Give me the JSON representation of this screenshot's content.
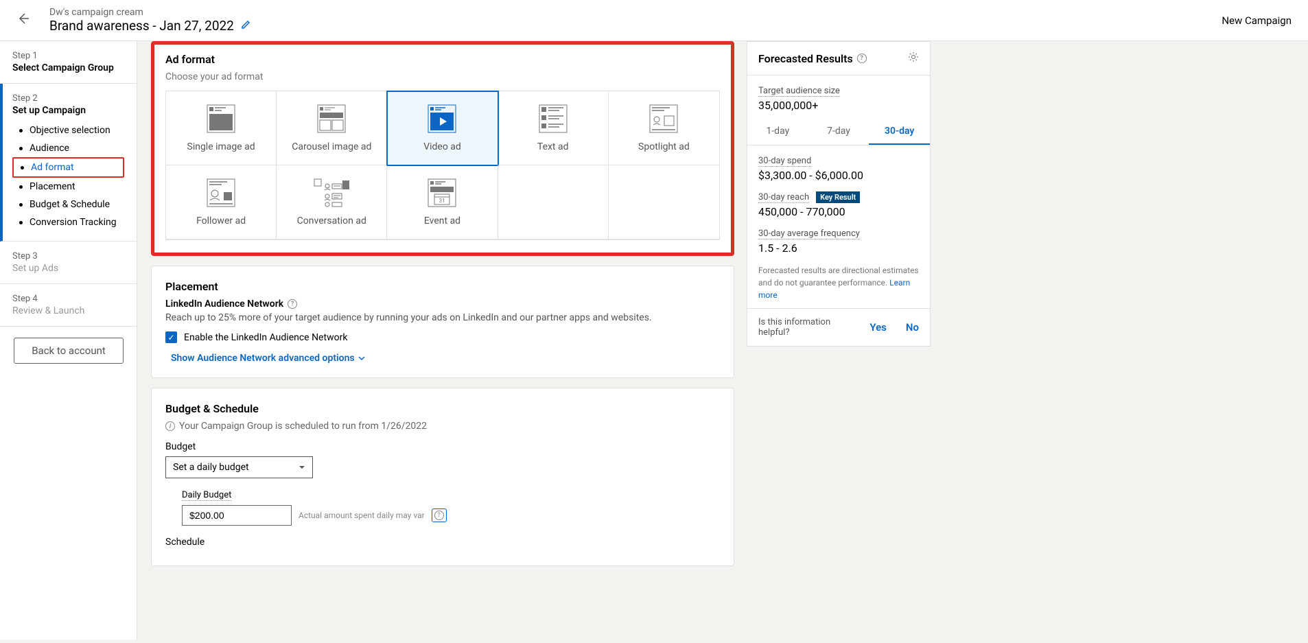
{
  "header": {
    "campaign_group": "Dw's campaign cream",
    "campaign_name": "Brand awareness - Jan 27, 2022",
    "new_campaign": "New Campaign"
  },
  "sidebar": {
    "step1": {
      "num": "Step 1",
      "title": "Select Campaign Group"
    },
    "step2": {
      "num": "Step 2",
      "title": "Set up Campaign",
      "items": [
        "Objective selection",
        "Audience",
        "Ad format",
        "Placement",
        "Budget & Schedule",
        "Conversion Tracking"
      ]
    },
    "step3": {
      "num": "Step 3",
      "title": "Set up Ads"
    },
    "step4": {
      "num": "Step 4",
      "title": "Review & Launch"
    },
    "back_btn": "Back to account"
  },
  "ad_format": {
    "title": "Ad format",
    "subtitle": "Choose your ad format",
    "options": [
      "Single image ad",
      "Carousel image ad",
      "Video ad",
      "Text ad",
      "Spotlight ad",
      "Follower ad",
      "Conversation ad",
      "Event ad"
    ]
  },
  "placement": {
    "title": "Placement",
    "network_label": "LinkedIn Audience Network",
    "desc": "Reach up to 25% more of your target audience by running your ads on LinkedIn and our partner apps and websites.",
    "checkbox_label": "Enable the LinkedIn Audience Network",
    "advanced_link": "Show Audience Network advanced options"
  },
  "budget": {
    "title": "Budget & Schedule",
    "info": "Your Campaign Group is scheduled to run from 1/26/2022",
    "budget_label": "Budget",
    "budget_select": "Set a daily budget",
    "daily_label": "Daily Budget",
    "daily_value": "$200.00",
    "daily_note": "Actual amount spent daily may var",
    "schedule_label": "Schedule"
  },
  "forecast": {
    "title": "Forecasted Results",
    "audience_label": "Target audience size",
    "audience_value": "35,000,000+",
    "tabs": [
      "1-day",
      "7-day",
      "30-day"
    ],
    "spend_label": "30-day spend",
    "spend_value": "$3,300.00 - $6,000.00",
    "reach_label": "30-day reach",
    "key_result": "Key Result",
    "reach_value": "450,000 - 770,000",
    "freq_label": "30-day average frequency",
    "freq_value": "1.5 - 2.6",
    "disclaimer": "Forecasted results are directional estimates and do not guarantee performance.",
    "learn_more": "Learn more",
    "helpful_text": "Is this information helpful?",
    "yes": "Yes",
    "no": "No"
  }
}
